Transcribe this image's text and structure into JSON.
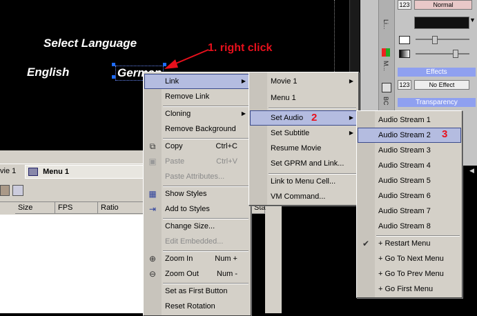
{
  "canvas": {
    "select_language": "Select Language",
    "english": "English",
    "german": "German"
  },
  "annotations": {
    "right_click": "1. right click",
    "step2": "2",
    "step3": "3",
    "color": "#e8101c"
  },
  "right_panel": {
    "num_field1": "123",
    "blend_mode": "Normal",
    "num_field2": "123",
    "effect": "No Effect",
    "effects_label": "Effects",
    "transparency_label": "Transparency",
    "vertical_labels": [
      "Li...",
      "M...",
      "BC"
    ]
  },
  "left_panel": {
    "tabs": [
      "vie 1",
      "Menu 1"
    ],
    "columns": [
      "Size",
      "FPS",
      "Ratio",
      "Sta"
    ]
  },
  "context_menu": {
    "items": [
      {
        "label": "Link",
        "arrow": true
      },
      {
        "label": "Remove Link"
      },
      {
        "label": "Cloning",
        "arrow": true
      },
      {
        "label": "Remove Background"
      },
      {
        "label": "Copy",
        "shortcut": "Ctrl+C"
      },
      {
        "label": "Paste",
        "shortcut": "Ctrl+V"
      },
      {
        "label": "Paste Attributes..."
      },
      {
        "label": "Show Styles"
      },
      {
        "label": "Add to Styles"
      },
      {
        "label": "Change Size..."
      },
      {
        "label": "Edit Embedded..."
      },
      {
        "label": "Zoom In",
        "shortcut": "Num +"
      },
      {
        "label": "Zoom Out",
        "shortcut": "Num -"
      },
      {
        "label": "Set as First Button"
      },
      {
        "label": "Reset Rotation"
      }
    ]
  },
  "link_submenu": {
    "items": [
      {
        "label": "Movie 1",
        "arrow": true
      },
      {
        "label": "Menu 1"
      },
      {
        "label": "Set Audio",
        "arrow": true
      },
      {
        "label": "Set Subtitle",
        "arrow": true
      },
      {
        "label": "Resume Movie"
      },
      {
        "label": "Set GPRM and Link..."
      },
      {
        "label": "Link to Menu Cell..."
      },
      {
        "label": "VM Command..."
      }
    ]
  },
  "audio_submenu": {
    "items": [
      {
        "label": "Audio Stream 1"
      },
      {
        "label": "Audio Stream 2"
      },
      {
        "label": "Audio Stream 3"
      },
      {
        "label": "Audio Stream 4"
      },
      {
        "label": "Audio Stream 5"
      },
      {
        "label": "Audio Stream 6"
      },
      {
        "label": "Audio Stream 7"
      },
      {
        "label": "Audio Stream 8"
      },
      {
        "label": "+ Restart Menu"
      },
      {
        "label": "+ Go To Next Menu"
      },
      {
        "label": "+ Go To Prev Menu"
      },
      {
        "label": "+ Go First Menu"
      }
    ]
  }
}
